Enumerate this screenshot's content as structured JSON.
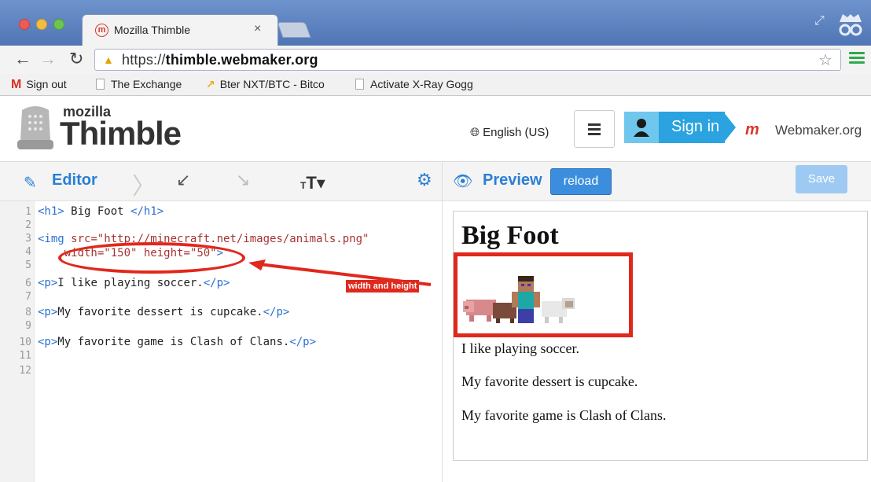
{
  "browser": {
    "tab_title": "Mozilla Thimble",
    "tab_favicon": "m",
    "tab_close": "×",
    "url_prefix": "https://",
    "url_domain": "thimble.webmaker.org"
  },
  "bookmarks": [
    {
      "label": "Sign out",
      "icon": "gmail-icon"
    },
    {
      "label": "The Exchange",
      "icon": "document-icon"
    },
    {
      "label": "Bter NXT/BTC - Bitco",
      "icon": "chart-icon"
    },
    {
      "label": "Activate X-Ray Gogg",
      "icon": "document-icon"
    }
  ],
  "header": {
    "logo_small": "mozilla",
    "logo_big": "Thimble",
    "language": "English (US)",
    "sign_in": "Sign in",
    "webmaker": "Webmaker.org"
  },
  "panebar": {
    "editor": "Editor",
    "preview": "Preview",
    "reload": "reload",
    "save": "Save",
    "font_toggle_small": "T",
    "font_toggle_big": "T"
  },
  "code": {
    "line_numbers": [
      "1",
      "2",
      "3",
      "4",
      "5",
      "6",
      "7",
      "8",
      "9",
      "10",
      "11",
      "12"
    ],
    "line1": {
      "open": "<h1>",
      "text": " Big Foot ",
      "close": "</h1>"
    },
    "line3": {
      "open": "<img",
      "attr": " src=",
      "val": "\"http://minecraft.net/images/animals.png\""
    },
    "line4": {
      "attr1": "width=",
      "val1": "\"150\"",
      "attr2": " height=",
      "val2": "\"50\"",
      "close": ">"
    },
    "line6": {
      "open": "<p>",
      "text": "I like playing soccer.",
      "close": "</p>"
    },
    "line8": {
      "open": "<p>",
      "text": "My favorite dessert is cupcake.",
      "close": "</p>"
    },
    "line10": {
      "open": "<p>",
      "text": "My favorite game is Clash of Clans.",
      "close": "</p>"
    }
  },
  "annotation": {
    "label": "width and height",
    "color": "#e0281c"
  },
  "preview": {
    "h1": "Big Foot",
    "p1": "I like playing soccer.",
    "p2": "My favorite dessert is cupcake.",
    "p3": "My favorite game is Clash of Clans."
  },
  "colors": {
    "accent": "#2a7fd4",
    "signin": "#2aa3e0",
    "annotation": "#e0281c"
  }
}
